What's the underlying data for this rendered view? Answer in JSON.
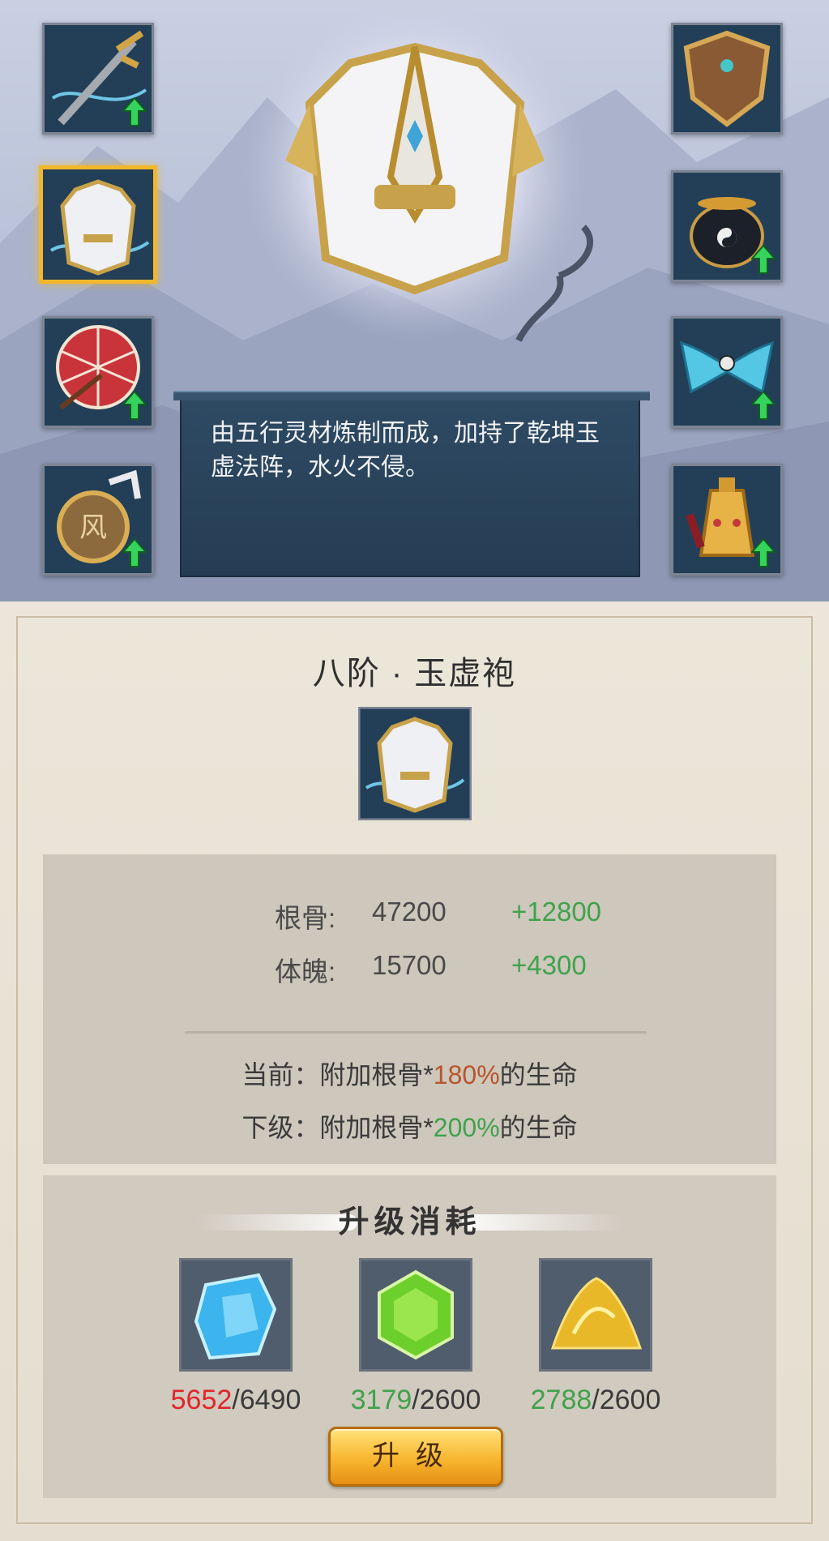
{
  "equipment_slots": {
    "left": [
      {
        "icon": "sword-icon",
        "upgradable": true,
        "selected": false
      },
      {
        "icon": "robe-icon",
        "upgradable": false,
        "selected": true
      },
      {
        "icon": "umbrella-icon",
        "upgradable": true,
        "selected": false
      },
      {
        "icon": "amulet-icon",
        "upgradable": true,
        "selected": false
      }
    ],
    "right": [
      {
        "icon": "shield-icon",
        "upgradable": false,
        "selected": false
      },
      {
        "icon": "cauldron-icon",
        "upgradable": true,
        "selected": false
      },
      {
        "icon": "bow-ornament-icon",
        "upgradable": true,
        "selected": false
      },
      {
        "icon": "bell-icon",
        "upgradable": true,
        "selected": false
      }
    ]
  },
  "description": "由五行灵材炼制而成，加持了乾坤玉虚法阵，水火不侵。",
  "item": {
    "title": "八阶 · 玉虚袍",
    "icon": "robe-icon"
  },
  "stats": [
    {
      "label": "根骨:",
      "value": "47200",
      "bonus": "+12800"
    },
    {
      "label": "体魄:",
      "value": "15700",
      "bonus": "+4300"
    }
  ],
  "effects": {
    "current": {
      "prefix": "当前：附加根骨*",
      "pct": "180%",
      "suffix": "的生命"
    },
    "next": {
      "prefix": "下级：附加根骨*",
      "pct": "200%",
      "suffix": "的生命"
    }
  },
  "cost": {
    "title": "升级消耗",
    "items": [
      {
        "icon": "blue-crystal-icon",
        "have": "5652",
        "need": "/6490",
        "sufficient": false
      },
      {
        "icon": "green-gem-icon",
        "have": "3179",
        "need": "/2600",
        "sufficient": true
      },
      {
        "icon": "gold-pile-icon",
        "have": "2788",
        "need": "/2600",
        "sufficient": true
      }
    ]
  },
  "upgrade_button": "升级",
  "colors": {
    "insufficient": "#e1262b",
    "sufficient": "#3fa24c",
    "current_pct": "#b9542d",
    "selected_border": "#f2b72a"
  }
}
